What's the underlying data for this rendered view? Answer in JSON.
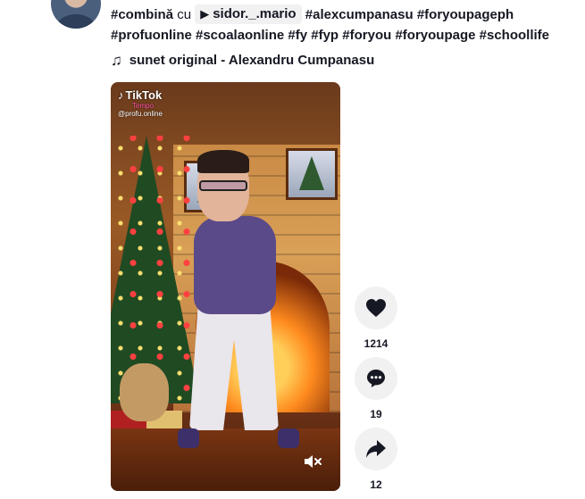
{
  "caption": {
    "line1_tag1": "#combină",
    "line1_connector": "cu",
    "duet_user": "sidor._.mario",
    "line1_tag2": "#alexcumpanasu",
    "line1_tag3": "#foryoupageph",
    "line2_tags": [
      "#profuonline",
      "#scoalaonline",
      "#fy",
      "#fyp",
      "#foryou",
      "#foryoupage",
      "#schoollife"
    ]
  },
  "music": {
    "icon": "music-note-icon",
    "label": "sunet original - Alexandru Cumpanasu"
  },
  "video": {
    "watermark_brand": "TikTok",
    "watermark_sub": "Tempo",
    "watermark_handle": "@profu.online",
    "mute_icon": "volume-muted-icon"
  },
  "actions": {
    "like": {
      "icon": "heart-icon",
      "count": "1214"
    },
    "comment": {
      "icon": "comment-icon",
      "count": "19"
    },
    "share": {
      "icon": "share-icon",
      "count": "12"
    }
  },
  "colors": {
    "text": "#161823",
    "button_bg": "#f1f1f2",
    "chip_bg": "#f1f1f2"
  }
}
